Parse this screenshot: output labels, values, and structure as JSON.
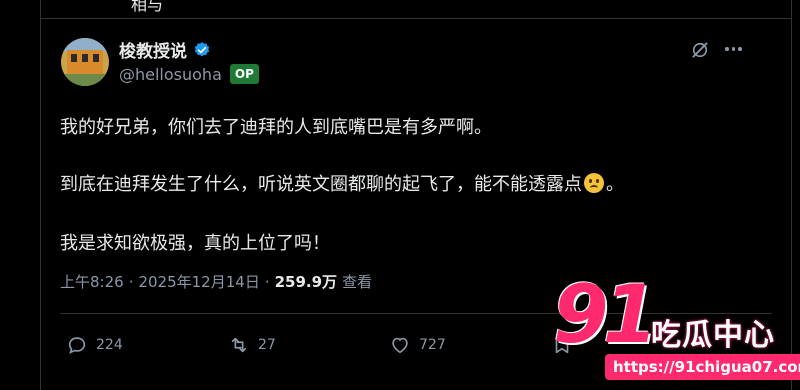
{
  "top_fragment": "相与",
  "author": {
    "display_name": "梭教授说",
    "handle": "@hellosuoha",
    "badge": "OP",
    "avatar_icon": "avatar-photo",
    "verified_icon": "verified-badge-icon"
  },
  "post": {
    "lines": [
      "我的好兄弟，你们去了迪拜的人到底嘴巴是有多严啊。",
      "到底在迪拜发生了什么，听说英文圈都聊的起飞了，能不能透露点",
      "。",
      "我是求知欲极强，真的上位了吗！"
    ]
  },
  "meta": {
    "time": "上午8:26",
    "sep1": "·",
    "date": "2025年12月14日",
    "sep2": "·",
    "views": "259.9万",
    "views_label": "查看"
  },
  "actions": {
    "reply_count": "224",
    "repost_count": "27",
    "like_count": "727"
  },
  "watermark": {
    "number": "91",
    "name": "吃瓜中心",
    "url": "https://91chigua07.com"
  },
  "colors": {
    "background": "#000000",
    "text": "#e7e9ea",
    "muted": "#8b98a5",
    "verified": "#1d9bf0",
    "op_badge": "#1f7a35",
    "watermark_pink": "#ff2a6d"
  }
}
